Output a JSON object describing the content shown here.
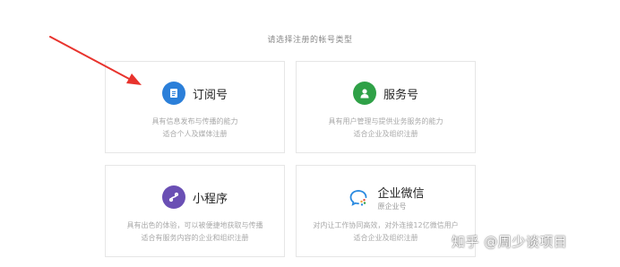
{
  "heading": "请选择注册的帐号类型",
  "accounts": [
    {
      "title": "订阅号",
      "desc_line1": "具有信息发布与传播的能力",
      "desc_line2": "适合个人及媒体注册",
      "icon": "document-icon",
      "color": "#2b7fd9"
    },
    {
      "title": "服务号",
      "desc_line1": "具有用户管理与提供业务服务的能力",
      "desc_line2": "适合企业及组织注册",
      "icon": "user-icon",
      "color": "#2fa147"
    },
    {
      "title": "小程序",
      "desc_line1": "具有出色的体验，可以被便捷地获取与传播",
      "desc_line2": "适合有服务内容的企业和组织注册",
      "icon": "miniprogram-icon",
      "color": "#6a4fb4"
    },
    {
      "title": "企业微信",
      "subtitle": "原企业号",
      "desc_line1": "对内让工作协同高效，对外连接12亿微信用户",
      "desc_line2": "适合企业及组织注册",
      "icon": "wecom-icon",
      "color": "#2a8ae0"
    }
  ],
  "watermark": "知乎 @周少谈项目",
  "annotation_color": "#e8332d"
}
